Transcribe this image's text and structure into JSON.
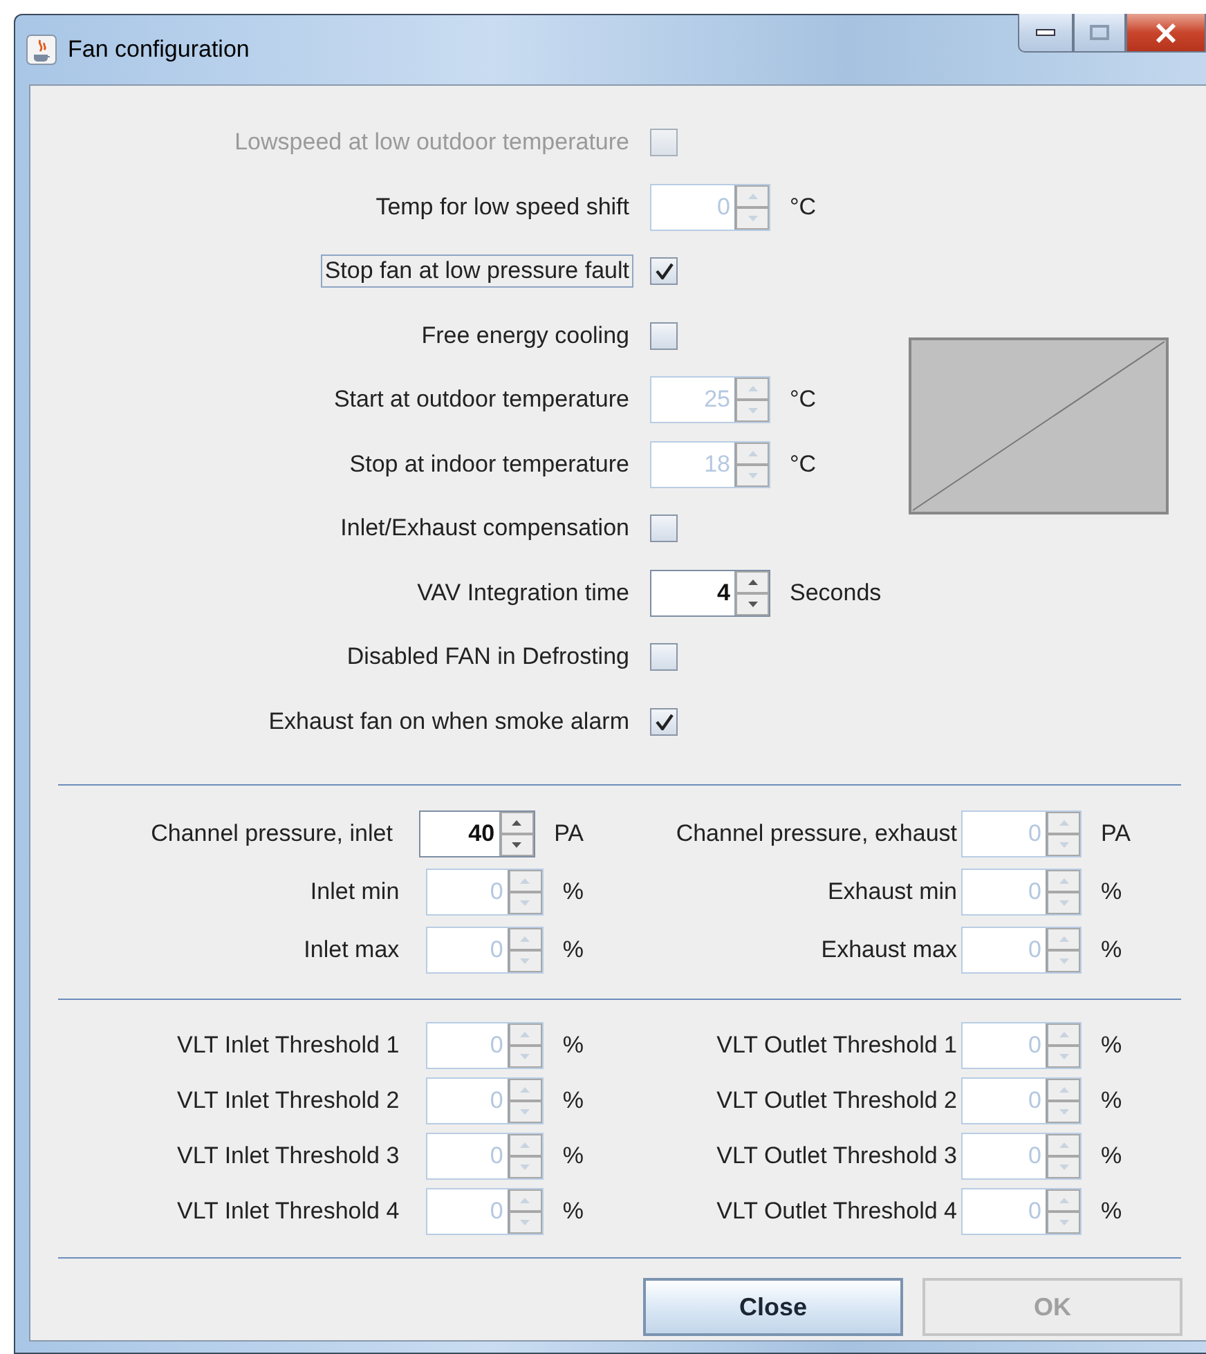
{
  "window": {
    "title": "Fan configuration"
  },
  "settings": [
    {
      "kind": "checkbox",
      "label": "Lowspeed at low outdoor temperature",
      "disabled": true,
      "focused": false,
      "checked": false
    },
    {
      "kind": "spinner",
      "label": "Temp for low speed shift",
      "value": "0",
      "unit": "°C",
      "disabled": true
    },
    {
      "kind": "checkbox",
      "label": "Stop fan at low pressure fault",
      "disabled": false,
      "focused": true,
      "checked": true
    },
    {
      "kind": "checkbox",
      "label": "Free energy cooling",
      "disabled": false,
      "focused": false,
      "checked": false
    },
    {
      "kind": "spinner",
      "label": "Start at outdoor temperature",
      "value": "25",
      "unit": "°C",
      "disabled": true
    },
    {
      "kind": "spinner",
      "label": "Stop at indoor temperature",
      "value": "18",
      "unit": "°C",
      "disabled": true
    },
    {
      "kind": "checkbox",
      "label": "Inlet/Exhaust compensation",
      "disabled": false,
      "focused": false,
      "checked": false
    },
    {
      "kind": "spinner",
      "label": "VAV Integration time",
      "value": "4",
      "unit": "Seconds",
      "disabled": false
    },
    {
      "kind": "checkbox",
      "label": "Disabled FAN in Defrosting",
      "disabled": false,
      "focused": false,
      "checked": false
    },
    {
      "kind": "checkbox",
      "label": "Exhaust fan on when smoke alarm",
      "disabled": false,
      "focused": false,
      "checked": true
    }
  ],
  "pressure_rows": [
    [
      {
        "label": "Channel pressure, inlet",
        "value": "40",
        "unit": "PA",
        "disabled": false
      },
      {
        "label": "Channel pressure, exhaust",
        "value": "0",
        "unit": "PA",
        "disabled": true
      }
    ],
    [
      {
        "label": "Inlet min",
        "value": "0",
        "unit": "%",
        "disabled": true
      },
      {
        "label": "Exhaust min",
        "value": "0",
        "unit": "%",
        "disabled": true
      }
    ],
    [
      {
        "label": "Inlet max",
        "value": "0",
        "unit": "%",
        "disabled": true
      },
      {
        "label": "Exhaust max",
        "value": "0",
        "unit": "%",
        "disabled": true
      }
    ]
  ],
  "threshold_rows": [
    [
      {
        "label": "VLT Inlet Threshold 1",
        "value": "0",
        "unit": "%",
        "disabled": true
      },
      {
        "label": "VLT Outlet Threshold 1",
        "value": "0",
        "unit": "%",
        "disabled": true
      }
    ],
    [
      {
        "label": "VLT Inlet Threshold 2",
        "value": "0",
        "unit": "%",
        "disabled": true
      },
      {
        "label": "VLT Outlet Threshold 2",
        "value": "0",
        "unit": "%",
        "disabled": true
      }
    ],
    [
      {
        "label": "VLT Inlet Threshold 3",
        "value": "0",
        "unit": "%",
        "disabled": true
      },
      {
        "label": "VLT Outlet Threshold 3",
        "value": "0",
        "unit": "%",
        "disabled": true
      }
    ],
    [
      {
        "label": "VLT Inlet Threshold 4",
        "value": "0",
        "unit": "%",
        "disabled": true
      },
      {
        "label": "VLT Outlet Threshold 4",
        "value": "0",
        "unit": "%",
        "disabled": true
      }
    ]
  ],
  "buttons": [
    {
      "label": "Close",
      "disabled": false
    },
    {
      "label": "OK",
      "disabled": true
    }
  ]
}
